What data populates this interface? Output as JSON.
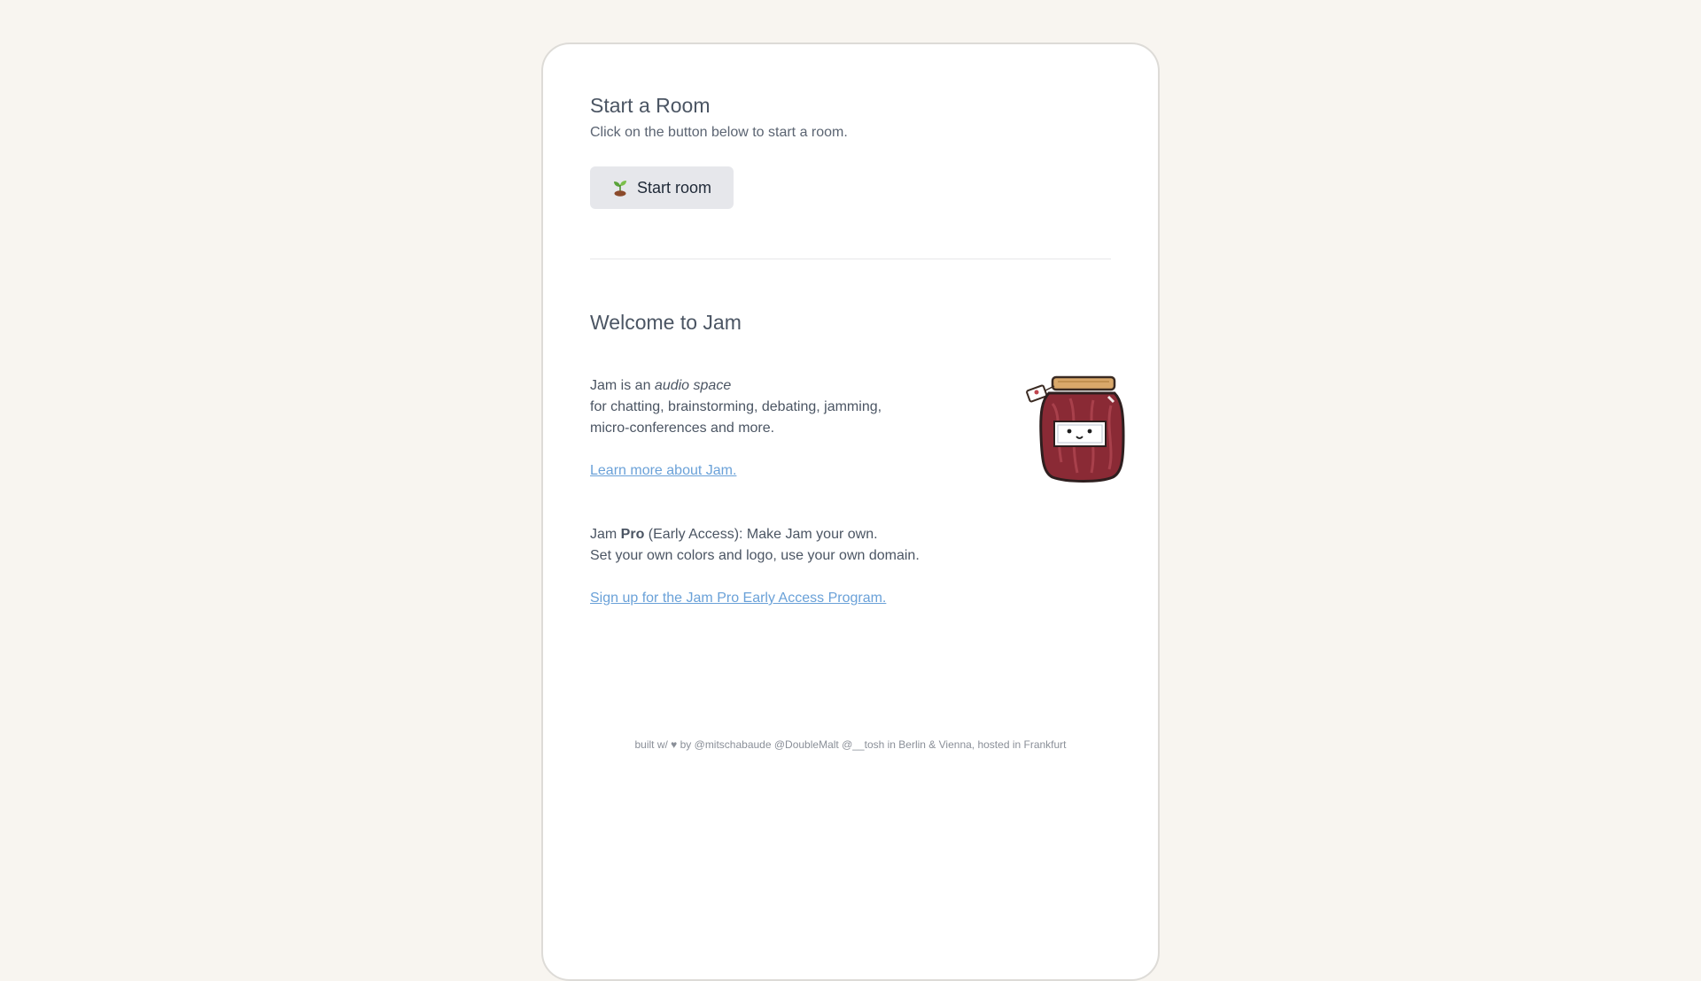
{
  "start_room": {
    "title": "Start a Room",
    "subtitle": "Click on the button below to start a room.",
    "button_label": "Start room",
    "button_icon": "sprout-icon"
  },
  "welcome": {
    "title": "Welcome to Jam",
    "intro_prefix": "Jam is an ",
    "intro_emphasis": "audio space",
    "intro_line2": "for chatting, brainstorming, debating, jamming,",
    "intro_line3": "micro-conferences and more.",
    "learn_more_link": "Learn more about Jam.",
    "pro_prefix": "Jam ",
    "pro_bold": "Pro",
    "pro_suffix": " (Early Access): Make Jam your own.",
    "pro_line2": "Set your own colors and logo, use your own domain.",
    "signup_link": "Sign up for the Jam Pro Early Access Program."
  },
  "footer": {
    "text": "built w/ ♥ by @mitschabaude @DoubleMalt @__tosh in Berlin & Vienna, hosted in Frankfurt"
  },
  "colors": {
    "page_background": "#f8f5f0",
    "link": "#6aa1d8",
    "button_background": "#e6e7eb",
    "jam": "#8a2a35"
  }
}
